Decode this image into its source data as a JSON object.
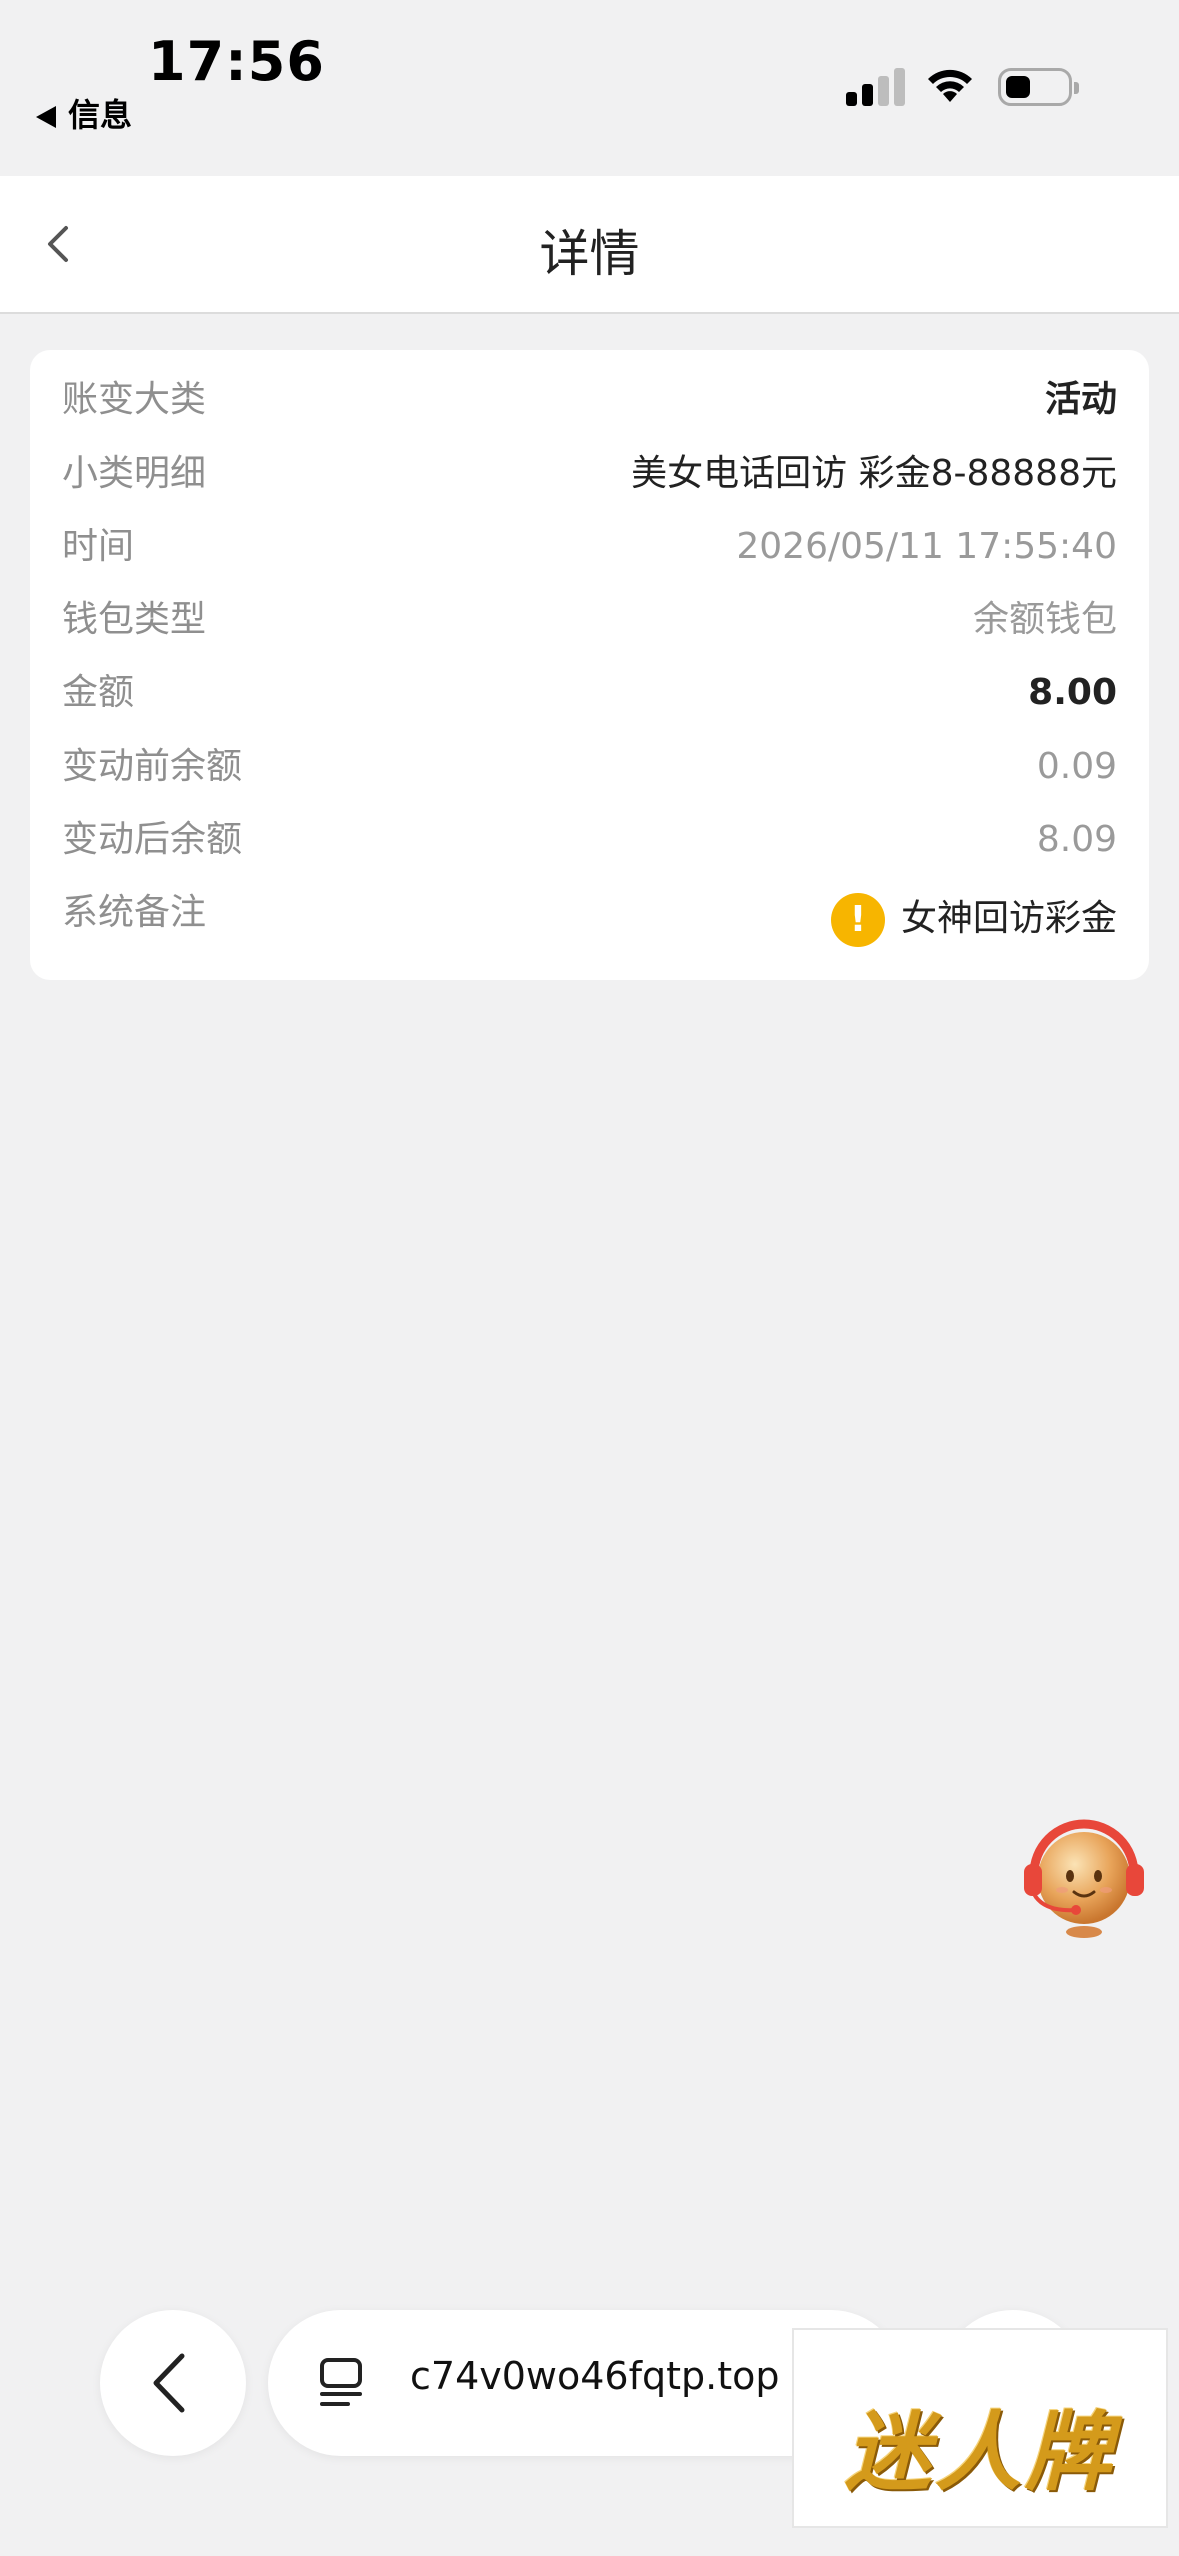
{
  "status_bar": {
    "time": "17:56",
    "back_app": "信息"
  },
  "nav": {
    "title": "详情"
  },
  "details": [
    {
      "label": "账变大类",
      "value": "活动",
      "style": "bold"
    },
    {
      "label": "小类明细",
      "value": "美女电话回访  彩金8-88888元",
      "style": "dark"
    },
    {
      "label": "时间",
      "value": "2026/05/11 17:55:40",
      "style": "muted"
    },
    {
      "label": "钱包类型",
      "value": "余额钱包",
      "style": "muted"
    },
    {
      "label": "金额",
      "value": "8.00",
      "style": "bold"
    },
    {
      "label": "变动前余额",
      "value": "0.09",
      "style": "muted"
    },
    {
      "label": "变动后余额",
      "value": "8.09",
      "style": "muted"
    },
    {
      "label": "系统备注",
      "value": "女神回访彩金",
      "style": "dark",
      "icon": "warning-icon",
      "icon_glyph": "!"
    }
  ],
  "browser": {
    "url": "c74v0wo46fqtp.top"
  },
  "watermark": {
    "text": "迷人牌"
  },
  "colors": {
    "background": "#f1f1f2",
    "warning": "#f7b500",
    "muted_text": "#9a9a9a"
  }
}
